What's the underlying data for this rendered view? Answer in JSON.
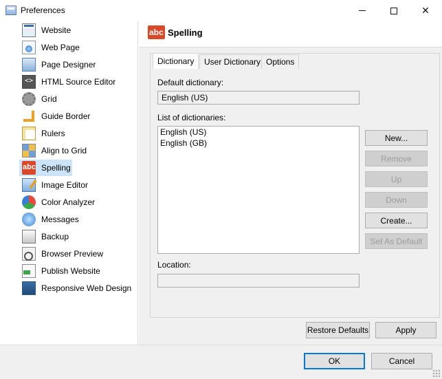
{
  "window": {
    "title": "Preferences",
    "controls": {
      "minimize": "minimize",
      "maximize": "maximize",
      "close": "✕"
    }
  },
  "sidebar": {
    "items": [
      {
        "label": "Website",
        "icon": "website-icon"
      },
      {
        "label": "Web Page",
        "icon": "web-page-icon"
      },
      {
        "label": "Page Designer",
        "icon": "page-designer-icon"
      },
      {
        "label": "HTML Source Editor",
        "icon": "html-source-icon"
      },
      {
        "label": "Grid",
        "icon": "grid-icon"
      },
      {
        "label": "Guide Border",
        "icon": "guide-border-icon"
      },
      {
        "label": "Rulers",
        "icon": "rulers-icon"
      },
      {
        "label": "Align to Grid",
        "icon": "align-grid-icon"
      },
      {
        "label": "Spelling",
        "icon": "spelling-icon",
        "selected": true
      },
      {
        "label": "Image Editor",
        "icon": "image-editor-icon"
      },
      {
        "label": "Color Analyzer",
        "icon": "color-analyzer-icon"
      },
      {
        "label": "Messages",
        "icon": "messages-icon"
      },
      {
        "label": "Backup",
        "icon": "backup-icon"
      },
      {
        "label": "Browser Preview",
        "icon": "browser-preview-icon"
      },
      {
        "label": "Publish Website",
        "icon": "publish-website-icon"
      },
      {
        "label": "Responsive Web Design",
        "icon": "responsive-design-icon"
      }
    ]
  },
  "header": {
    "title": "Spelling",
    "icon_text": "abc"
  },
  "tabs": [
    {
      "label": "Dictionary",
      "active": true
    },
    {
      "label": "User Dictionary",
      "active": false
    },
    {
      "label": "Options",
      "active": false
    }
  ],
  "dictionary": {
    "default_label": "Default dictionary:",
    "default_value": "English (US)",
    "list_label": "List of dictionaries:",
    "list": [
      "English (US)",
      "English (GB)"
    ],
    "location_label": "Location:",
    "location_value": ""
  },
  "side_buttons": {
    "new": "New...",
    "remove": "Remove",
    "up": "Up",
    "down": "Down",
    "create": "Create...",
    "set_default": "Set As Default"
  },
  "footer": {
    "restore_defaults": "Restore Defaults",
    "apply": "Apply",
    "ok": "OK",
    "cancel": "Cancel"
  },
  "colors": {
    "selected_bg": "#cce4f7",
    "spelling_red": "#d8492a",
    "default_button_border": "#0078d7"
  }
}
